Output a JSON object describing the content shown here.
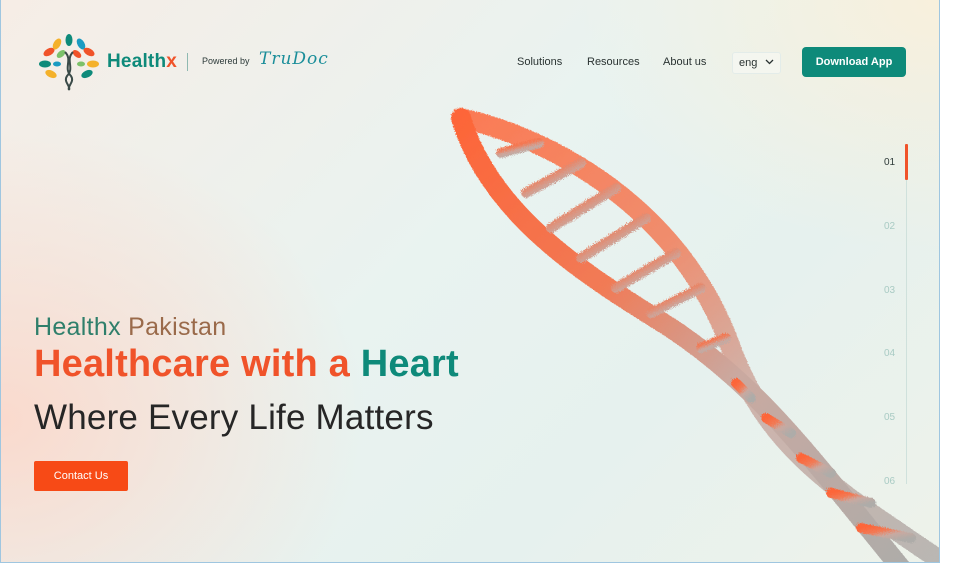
{
  "header": {
    "brand_main": "Health",
    "brand_x": "x",
    "powered_by": "Powered by",
    "partner": "TruDoc",
    "nav": [
      {
        "label": "Solutions"
      },
      {
        "label": "Resources"
      },
      {
        "label": "About us"
      }
    ],
    "language": "eng",
    "download_label": "Download App"
  },
  "hero": {
    "eyebrow_a": "Healthx",
    "eyebrow_b": "Pakistan",
    "headline_a": "Healthcare with a",
    "headline_b": "Heart",
    "subheadline": "Where Every Life Matters",
    "cta_label": "Contact Us"
  },
  "slider": {
    "items": [
      "01",
      "02",
      "03",
      "04",
      "05",
      "06"
    ],
    "active": "01"
  },
  "colors": {
    "teal": "#0e8a7a",
    "orange": "#f0532a",
    "cta": "#f74a16"
  },
  "icons": {
    "logo": "tree-dna-logo",
    "language_chevron": "chevron-down-icon",
    "hero_image": "dna-helix-image"
  }
}
